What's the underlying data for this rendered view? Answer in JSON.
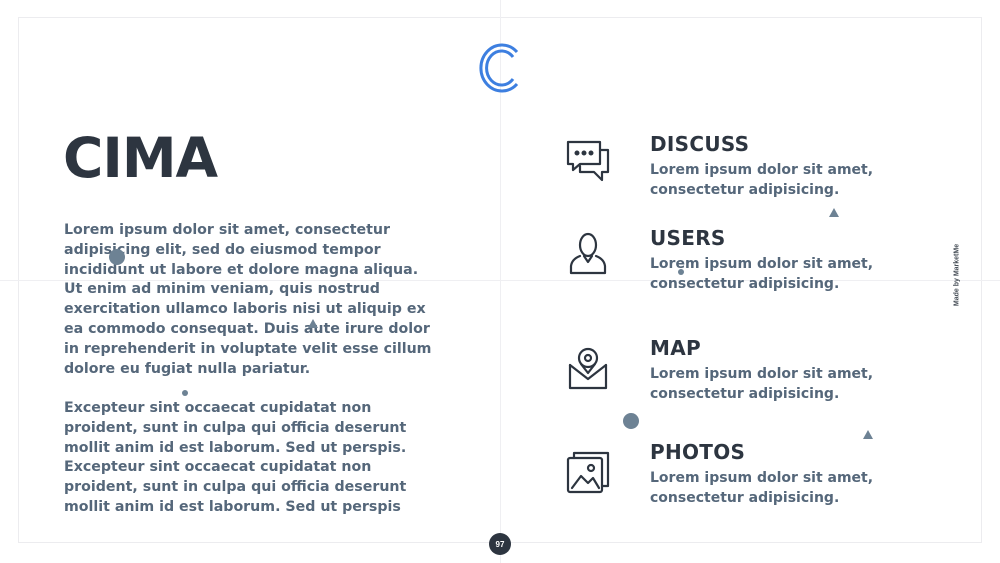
{
  "slide": {
    "title": "CIMA",
    "paragraph_1": "Lorem ipsum dolor sit amet, consectetur adipisicing elit, sed do eiusmod tempor incididunt ut labore et dolore magna aliqua. Ut enim ad minim veniam, quis nostrud exercitation ullamco laboris nisi ut aliquip ex ea commodo consequat. Duis aute irure dolor in reprehenderit in voluptate velit esse cillum dolore eu fugiat nulla pariatur.",
    "paragraph_2": "Excepteur sint occaecat cupidatat non proident, sunt in culpa qui officia deserunt mollit anim id est laborum. Sed ut perspis. Excepteur sint occaecat cupidatat non proident, sunt in culpa qui officia deserunt mollit anim id est laborum. Sed ut perspis",
    "credit": "Made by MarketMe",
    "page_number": "97"
  },
  "features": [
    {
      "title": "DISCUSS",
      "description": "Lorem ipsum dolor sit amet, consectetur adipisicing.",
      "icon": "chat-bubbles-icon"
    },
    {
      "title": "USERS",
      "description": "Lorem ipsum dolor sit amet, consectetur adipisicing.",
      "icon": "user-icon"
    },
    {
      "title": "MAP",
      "description": "Lorem ipsum dolor sit amet, consectetur adipisicing.",
      "icon": "map-pin-icon"
    },
    {
      "title": "PHOTOS",
      "description": "Lorem ipsum dolor sit amet, consectetur adipisicing.",
      "icon": "photos-icon"
    }
  ],
  "colors": {
    "accent": "#3d7fe0",
    "heading": "#2d3540",
    "body": "#55677a",
    "decoration": "#6d8294"
  }
}
